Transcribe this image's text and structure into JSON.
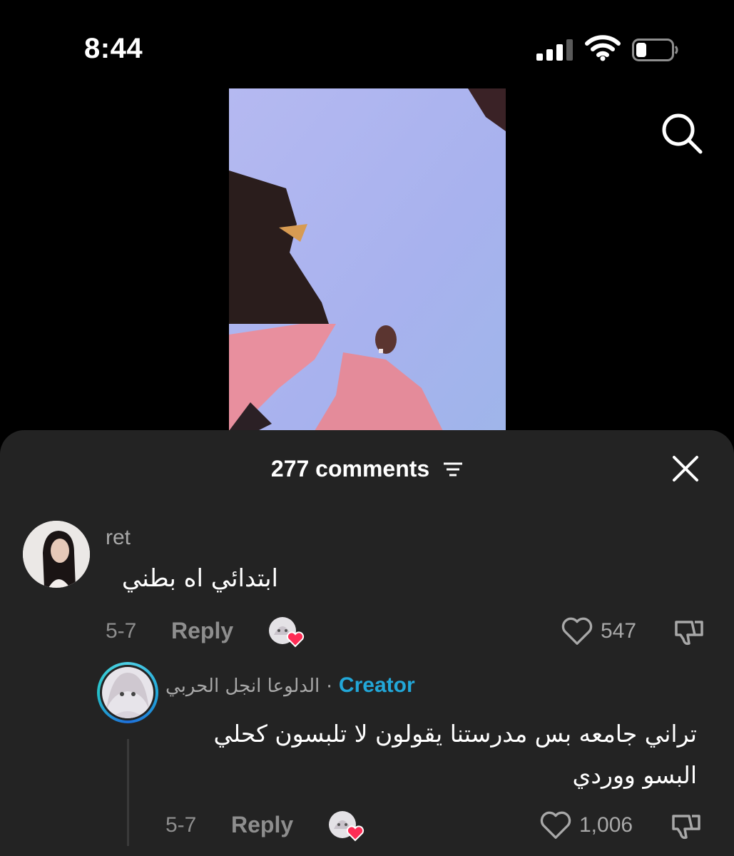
{
  "status_bar": {
    "time": "8:44"
  },
  "comments_panel": {
    "count_label": "277 comments",
    "comments": [
      {
        "username": "ret",
        "text": "ابتدائي اه بطني",
        "date": "5-7",
        "reply_label": "Reply",
        "likes": "547"
      },
      {
        "username": "الدلوعا انجل الحربي",
        "separator": "·",
        "badge": "Creator",
        "text": "تراني جامعه بس مدرستنا يقولون لا تلبسون كحلي البسو ووردي",
        "date": "5-7",
        "reply_label": "Reply",
        "likes": "1,006"
      }
    ]
  },
  "colors": {
    "panel": "#232323",
    "creator": "#22a7d8",
    "heart": "#fe2c55",
    "muted": "#8e8e8e"
  },
  "icons": [
    "signal-icon",
    "wifi-icon",
    "battery-icon",
    "search-icon",
    "sort-icon",
    "close-icon",
    "heart-outline-icon",
    "dislike-icon",
    "creator-liked-heart-icon"
  ]
}
